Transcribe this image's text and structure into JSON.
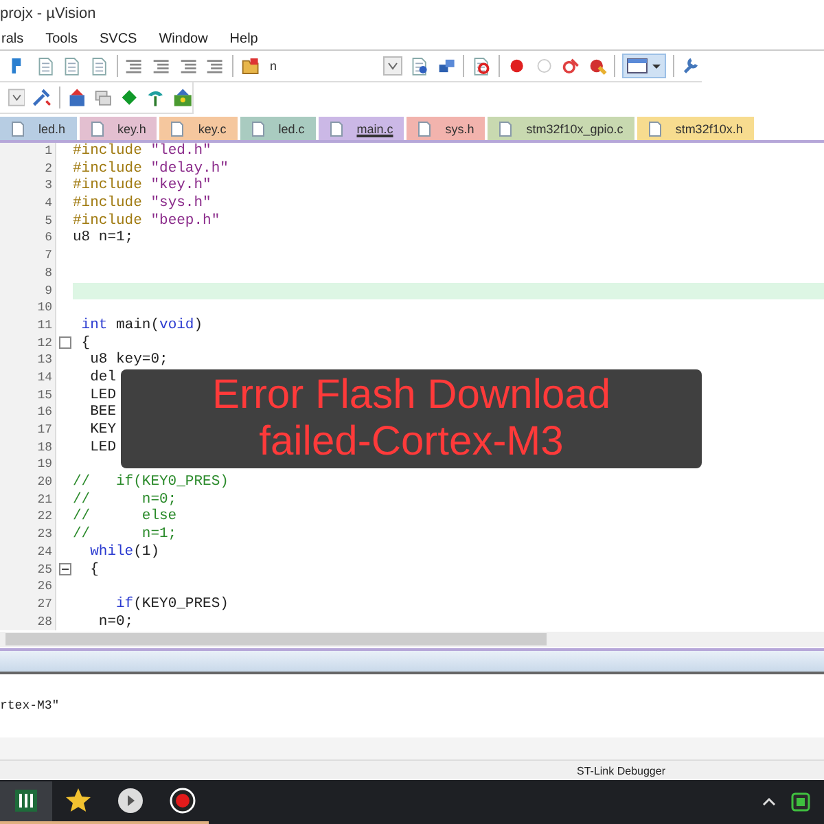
{
  "window": {
    "title": "projx - µVision"
  },
  "menu": [
    {
      "label": "rals"
    },
    {
      "label": "Tools"
    },
    {
      "label": "SVCS"
    },
    {
      "label": "Window"
    },
    {
      "label": "Help"
    }
  ],
  "find_box": {
    "value": "n"
  },
  "tabs": [
    {
      "label": "led.h",
      "color": "#b7cde3",
      "selected": false
    },
    {
      "label": "key.h",
      "color": "#e3bfd0",
      "selected": false
    },
    {
      "label": "key.c",
      "color": "#f5c79e",
      "selected": false
    },
    {
      "label": "led.c",
      "color": "#a9cbc0",
      "selected": false
    },
    {
      "label": "main.c",
      "color": "#cbb8e6",
      "selected": true
    },
    {
      "label": "sys.h",
      "color": "#f2b3ad",
      "selected": false
    },
    {
      "label": "stm32f10x_gpio.c",
      "color": "#c8d9b0",
      "selected": false
    },
    {
      "label": "stm32f10x.h",
      "color": "#f7dc8f",
      "selected": false
    }
  ],
  "editor": {
    "lines": [
      {
        "number": "1",
        "tokens": [
          {
            "kind": "pp",
            "text": "#include "
          },
          {
            "kind": "str",
            "text": "\"led.h\""
          }
        ]
      },
      {
        "number": "2",
        "tokens": [
          {
            "kind": "pp",
            "text": "#include "
          },
          {
            "kind": "str",
            "text": "\"delay.h\""
          }
        ]
      },
      {
        "number": "3",
        "tokens": [
          {
            "kind": "pp",
            "text": "#include "
          },
          {
            "kind": "str",
            "text": "\"key.h\""
          }
        ]
      },
      {
        "number": "4",
        "tokens": [
          {
            "kind": "pp",
            "text": "#include "
          },
          {
            "kind": "str",
            "text": "\"sys.h\""
          }
        ]
      },
      {
        "number": "5",
        "tokens": [
          {
            "kind": "pp",
            "text": "#include "
          },
          {
            "kind": "str",
            "text": "\"beep.h\""
          }
        ]
      },
      {
        "number": "6",
        "tokens": [
          {
            "kind": "txt",
            "text": "u8 n=1;"
          }
        ]
      },
      {
        "number": "7"
      },
      {
        "number": "8"
      },
      {
        "number": "9",
        "current": true
      },
      {
        "number": "10"
      },
      {
        "number": "11",
        "tokens": [
          {
            "kind": "kw",
            "text": " int "
          },
          {
            "kind": "txt",
            "text": "main("
          },
          {
            "kind": "kw",
            "text": "void"
          },
          {
            "kind": "txt",
            "text": ")"
          }
        ]
      },
      {
        "number": "12",
        "fold_marker": true,
        "expanded": false,
        "tokens": [
          {
            "kind": "txt",
            "text": " {"
          }
        ]
      },
      {
        "number": "13",
        "tokens": [
          {
            "kind": "txt",
            "text": "  u8 key=0;"
          }
        ]
      },
      {
        "number": "14",
        "tokens": [
          {
            "kind": "txt",
            "text": "  del"
          }
        ]
      },
      {
        "number": "15",
        "tokens": [
          {
            "kind": "txt",
            "text": "  LED"
          }
        ]
      },
      {
        "number": "16",
        "tokens": [
          {
            "kind": "txt",
            "text": "  BEE"
          }
        ]
      },
      {
        "number": "17",
        "tokens": [
          {
            "kind": "txt",
            "text": "  KEY"
          }
        ]
      },
      {
        "number": "18",
        "tokens": [
          {
            "kind": "txt",
            "text": "  LED"
          }
        ]
      },
      {
        "number": "19"
      },
      {
        "number": "20",
        "tokens": [
          {
            "kind": "cmt",
            "text": "//   if(KEY0_PRES)"
          }
        ]
      },
      {
        "number": "21",
        "tokens": [
          {
            "kind": "cmt",
            "text": "//      n=0;"
          }
        ]
      },
      {
        "number": "22",
        "tokens": [
          {
            "kind": "cmt",
            "text": "//      else"
          }
        ]
      },
      {
        "number": "23",
        "tokens": [
          {
            "kind": "cmt",
            "text": "//      n=1;"
          }
        ]
      },
      {
        "number": "24",
        "tokens": [
          {
            "kind": "kw",
            "text": "  while"
          },
          {
            "kind": "txt",
            "text": "(1)"
          }
        ]
      },
      {
        "number": "25",
        "fold_marker": true,
        "expanded": true,
        "tokens": [
          {
            "kind": "txt",
            "text": "  {"
          }
        ]
      },
      {
        "number": "26"
      },
      {
        "number": "27",
        "tokens": [
          {
            "kind": "kw",
            "text": "     if"
          },
          {
            "kind": "txt",
            "text": "(KEY0_PRES)"
          }
        ]
      },
      {
        "number": "28",
        "tokens": [
          {
            "kind": "txt",
            "text": "   n=0;"
          }
        ]
      }
    ]
  },
  "overlay": {
    "lines": [
      "Error Flash Download",
      "failed-Cortex-M3"
    ]
  },
  "output": {
    "text": "rtex-M3\""
  },
  "status_bar": {
    "debugger": "ST-Link Debugger"
  }
}
